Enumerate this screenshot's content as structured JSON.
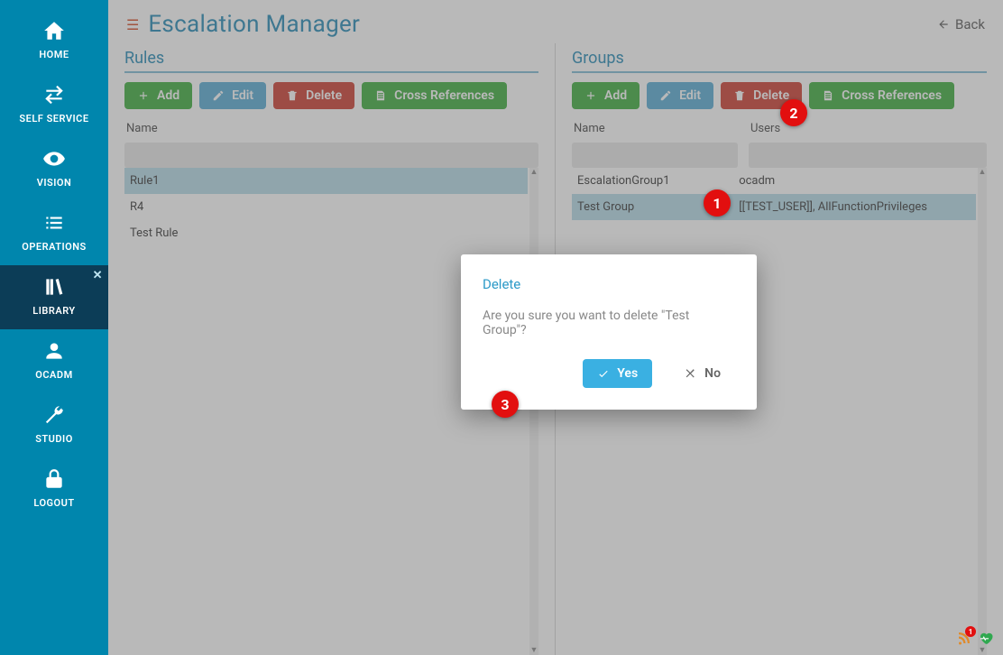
{
  "sidebar": {
    "items": [
      {
        "label": "HOME"
      },
      {
        "label": "SELF SERVICE"
      },
      {
        "label": "VISION"
      },
      {
        "label": "OPERATIONS"
      },
      {
        "label": "LIBRARY"
      },
      {
        "label": "OCADM"
      },
      {
        "label": "STUDIO"
      },
      {
        "label": "LOGOUT"
      }
    ]
  },
  "header": {
    "title": "Escalation Manager",
    "back": "Back"
  },
  "panels": {
    "rules": {
      "title": "Rules",
      "add": "Add",
      "edit": "Edit",
      "delete": "Delete",
      "cross": "Cross References",
      "col_name": "Name",
      "rows": [
        {
          "name": "Rule1"
        },
        {
          "name": "R4"
        },
        {
          "name": "Test Rule"
        }
      ]
    },
    "groups": {
      "title": "Groups",
      "add": "Add",
      "edit": "Edit",
      "delete": "Delete",
      "cross": "Cross References",
      "col_name": "Name",
      "col_users": "Users",
      "rows": [
        {
          "name": "EscalationGroup1",
          "users": "ocadm"
        },
        {
          "name": "Test Group",
          "users": "[[TEST_USER]], AllFunctionPrivileges"
        }
      ]
    }
  },
  "modal": {
    "title": "Delete",
    "message": "Are you sure you want to delete \"Test Group\"?",
    "yes": "Yes",
    "no": "No"
  },
  "annotations": {
    "a1": "1",
    "a2": "2",
    "a3": "3"
  },
  "status": {
    "feed_count": "1"
  }
}
